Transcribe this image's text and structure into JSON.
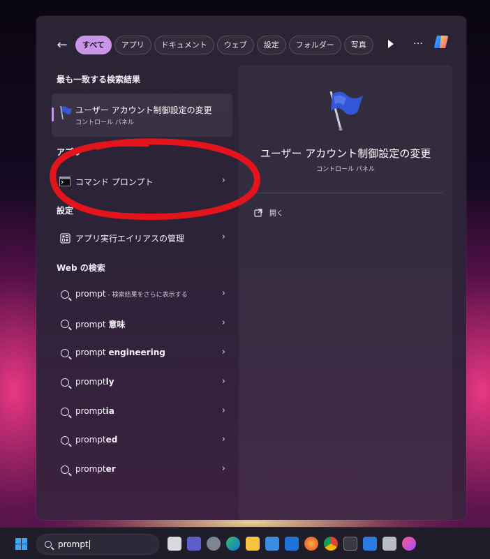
{
  "filters": {
    "back_label": "←",
    "chips": [
      "すべて",
      "アプリ",
      "ドキュメント",
      "ウェブ",
      "設定",
      "フォルダー",
      "写真"
    ],
    "more_label": "…"
  },
  "left": {
    "best_match_heading": "最も一致する検索結果",
    "best_match": {
      "title": "ユーザー アカウント制御設定の変更",
      "subtitle": "コントロール パネル",
      "icon": "uac-flag-icon"
    },
    "apps_heading": "アプリ",
    "apps": [
      {
        "label": "コマンド プロンプト",
        "icon": "terminal-icon"
      }
    ],
    "settings_heading": "設定",
    "settings": [
      {
        "label": "アプリ実行エイリアスの管理",
        "icon": "app-alias-icon"
      }
    ],
    "web_heading": "Web の検索",
    "web": [
      {
        "query": "prompt",
        "hint": " - 検索結果をさらに表示する"
      },
      {
        "query": "prompt ",
        "bold": "意味"
      },
      {
        "query": "prompt ",
        "bold": "engineering"
      },
      {
        "query": "prompt",
        "bold": "ly"
      },
      {
        "query": "prompt",
        "bold": "ia"
      },
      {
        "query": "prompt",
        "bold": "ed"
      },
      {
        "query": "prompt",
        "bold": "er"
      }
    ],
    "chevron": "›"
  },
  "detail": {
    "title": "ユーザー アカウント制御設定の変更",
    "subtitle": "コントロール パネル",
    "open_label": "開く"
  },
  "taskbar": {
    "search_value": "prompt",
    "icons": [
      "file-explorer-widget-icon",
      "teams-icon",
      "settings-icon",
      "edge-icon",
      "folder-icon",
      "store-icon",
      "mail-icon",
      "firefox-icon",
      "chrome-icon",
      "terminal-icon",
      "app-icon",
      "network-icon",
      "music-icon"
    ]
  },
  "colors": {
    "accent": "#c995e6",
    "annotation": "#e3141c"
  }
}
